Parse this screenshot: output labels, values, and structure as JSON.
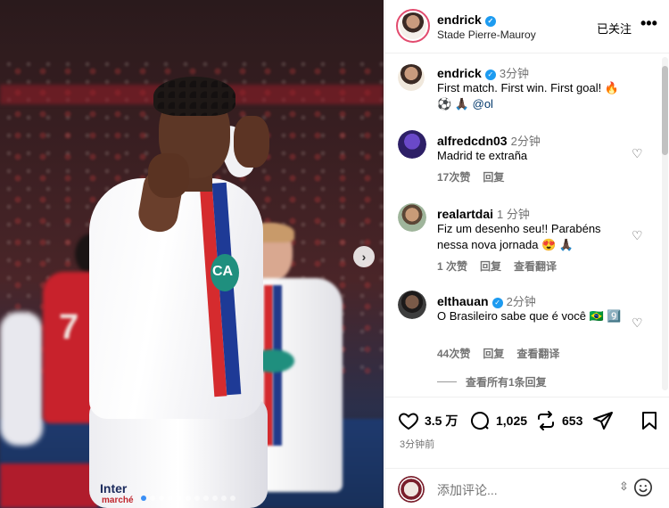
{
  "post": {
    "author": "endrick",
    "location": "Stade Pierre-Mauroy",
    "follow_label": "已关注",
    "more_label": "•••",
    "photo_sponsor": "Inter",
    "photo_sponsor_sub": "marché",
    "photo_badge": "CA",
    "photo_jersey_number": "7",
    "carousel_count": 11,
    "carousel_active_index": 0,
    "caption": {
      "author": "endrick",
      "time": "3分钟",
      "text": "First match. First win. First goal! 🔥",
      "emojis": "⚽ 🙏🏿",
      "mention": "@ol"
    }
  },
  "comments": [
    {
      "author": "alfredcdn03",
      "time": "2分钟",
      "text": "Madrid te extraña",
      "likes": "17次赞",
      "reply": "回复",
      "translate": ""
    },
    {
      "author": "realartdai",
      "time": "1 分钟",
      "text": "Fiz um desenho seu!! Parabéns nessa nova jornada 😍 🙏🏿",
      "likes": "1 次赞",
      "reply": "回复",
      "translate": "查看翻译"
    },
    {
      "author": "elthauan",
      "time": "2分钟",
      "text": "O Brasileiro sabe que é você 🇧🇷 9️⃣",
      "likes": "44次赞",
      "reply": "回复",
      "translate": "查看翻译",
      "see_all": "查看所有1条回复"
    }
  ],
  "actions": {
    "likes": "3.5 万",
    "comments": "1,025",
    "reposts": "653",
    "posted_ago": "3分钟前"
  },
  "composer": {
    "placeholder": "添加评论...",
    "sort_glyph": "⇳"
  },
  "colors": {
    "verified": "#1d9bf0",
    "link": "#00376b",
    "muted": "#737373",
    "story_ring": "#e24b6e"
  }
}
